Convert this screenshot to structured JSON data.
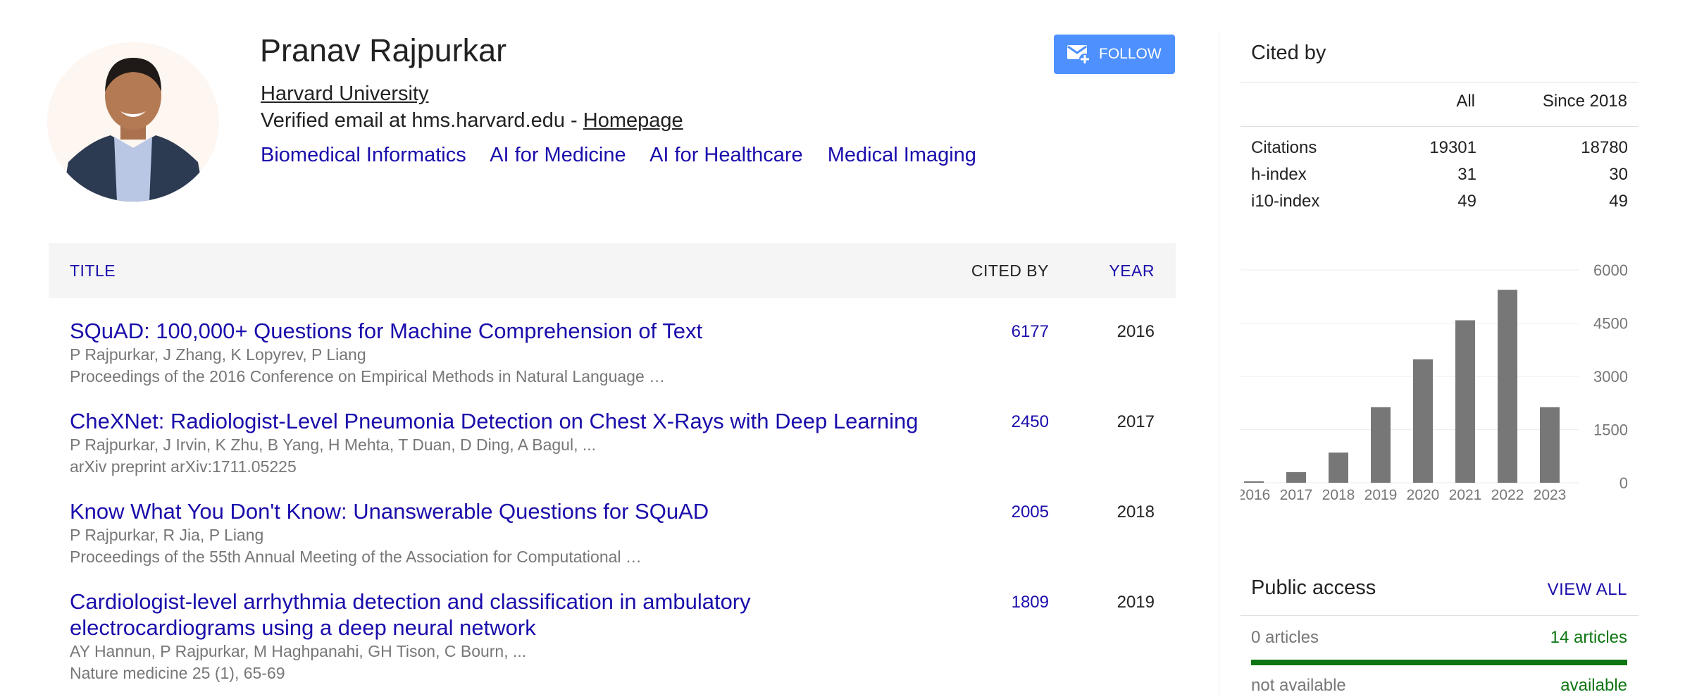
{
  "profile": {
    "name": "Pranav Rajpurkar",
    "affiliation": "Harvard University",
    "email_text": "Verified email at hms.harvard.edu - ",
    "homepage_label": "Homepage",
    "interests": [
      "Biomedical Informatics",
      "AI for Medicine",
      "AI for Healthcare",
      "Medical Imaging"
    ],
    "follow_label": "FOLLOW"
  },
  "table": {
    "headers": {
      "title": "TITLE",
      "cited_by": "CITED BY",
      "year": "YEAR"
    },
    "rows": [
      {
        "title": "SQuAD: 100,000+ Questions for Machine Comprehension of Text",
        "authors": "P Rajpurkar, J Zhang, K Lopyrev, P Liang",
        "venue": "Proceedings of the 2016 Conference on Empirical Methods in Natural Language …",
        "cited_by": "6177",
        "year": "2016"
      },
      {
        "title": "CheXNet: Radiologist-Level Pneumonia Detection on Chest X-Rays with Deep Learning",
        "authors": "P Rajpurkar, J Irvin, K Zhu, B Yang, H Mehta, T Duan, D Ding, A Bagul, ...",
        "venue": "arXiv preprint arXiv:1711.05225",
        "cited_by": "2450",
        "year": "2017"
      },
      {
        "title": "Know What You Don't Know: Unanswerable Questions for SQuAD",
        "authors": "P Rajpurkar, R Jia, P Liang",
        "venue": "Proceedings of the 55th Annual Meeting of the Association for Computational …",
        "cited_by": "2005",
        "year": "2018"
      },
      {
        "title": "Cardiologist-level arrhythmia detection and classification in ambulatory electrocardiograms using a deep neural network",
        "authors": "AY Hannun, P Rajpurkar, M Haghpanahi, GH Tison, C Bourn, ...",
        "venue": "Nature medicine 25 (1), 65-69",
        "cited_by": "1809",
        "year": "2019"
      }
    ]
  },
  "cited_by": {
    "title": "Cited by",
    "col_all": "All",
    "col_since": "Since 2018",
    "rows": [
      {
        "label": "Citations",
        "all": "19301",
        "since": "18780"
      },
      {
        "label": "h-index",
        "all": "31",
        "since": "30"
      },
      {
        "label": "i10-index",
        "all": "49",
        "since": "49"
      }
    ]
  },
  "chart_data": {
    "type": "bar",
    "categories": [
      "2016",
      "2017",
      "2018",
      "2019",
      "2020",
      "2021",
      "2022",
      "2023"
    ],
    "values": [
      40,
      300,
      850,
      2130,
      3480,
      4580,
      5440,
      2130
    ],
    "ylim": [
      0,
      6000
    ],
    "yticks": [
      "6000",
      "4500",
      "3000",
      "1500",
      "0"
    ],
    "ytick_values": [
      6000,
      4500,
      3000,
      1500,
      0
    ],
    "bar_color": "#777777",
    "grid": true
  },
  "public_access": {
    "title": "Public access",
    "view_all": "VIEW ALL",
    "unavailable_count": "0 articles",
    "available_count": "14 articles",
    "available_fraction": 1.0,
    "not_available_label": "not available",
    "available_label": "available"
  },
  "colors": {
    "link": "#1a0dab",
    "follow_button": "#4d90fe",
    "available_green": "#0d7612"
  }
}
